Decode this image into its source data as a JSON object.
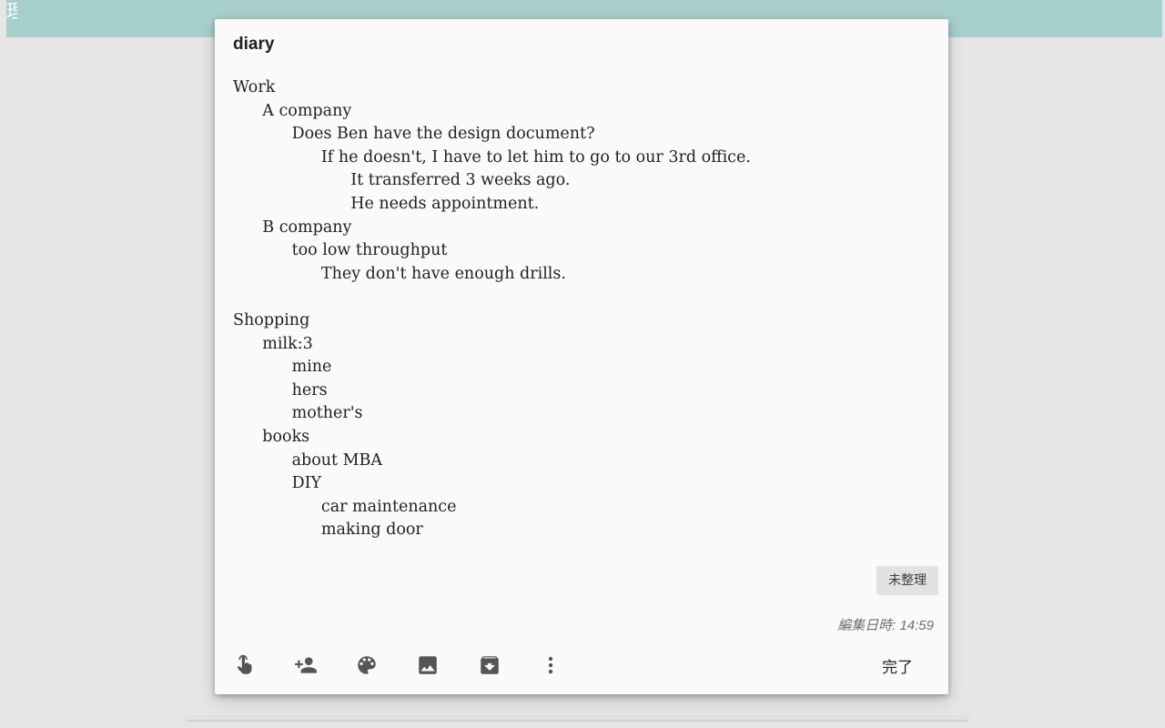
{
  "topbar": {
    "glyph": "理"
  },
  "note": {
    "title": "diary",
    "lines": [
      {
        "indent": 0,
        "text": "Work"
      },
      {
        "indent": 1,
        "text": "A company"
      },
      {
        "indent": 2,
        "text": "Does Ben have the design document?"
      },
      {
        "indent": 3,
        "text": "If he doesn't, I have to let him to go to our 3rd office."
      },
      {
        "indent": 4,
        "text": "It transferred 3 weeks ago."
      },
      {
        "indent": 4,
        "text": "He needs appointment."
      },
      {
        "indent": 1,
        "text": "B company"
      },
      {
        "indent": 2,
        "text": "too low throughput"
      },
      {
        "indent": 3,
        "text": "They don't have enough drills."
      },
      {
        "indent": 0,
        "text": ""
      },
      {
        "indent": 0,
        "text": "Shopping"
      },
      {
        "indent": 1,
        "text": "milk:3"
      },
      {
        "indent": 2,
        "text": "mine"
      },
      {
        "indent": 2,
        "text": "hers"
      },
      {
        "indent": 2,
        "text": "mother's"
      },
      {
        "indent": 1,
        "text": "books"
      },
      {
        "indent": 2,
        "text": "about MBA"
      },
      {
        "indent": 2,
        "text": "DIY"
      },
      {
        "indent": 3,
        "text": "car maintenance"
      },
      {
        "indent": 3,
        "text": "making door"
      }
    ],
    "label_chip": "未整理",
    "edited_text": "編集日時: 14:59"
  },
  "toolbar": {
    "icons": [
      "remind-me-icon",
      "collaborator-icon",
      "palette-icon",
      "image-icon",
      "archive-icon",
      "more-vert-icon"
    ],
    "done_label": "完了"
  },
  "colors": {
    "topbar": "#a7cfcc",
    "background": "#e6e6e6",
    "note": "#fafafa",
    "icon": "#555555"
  }
}
